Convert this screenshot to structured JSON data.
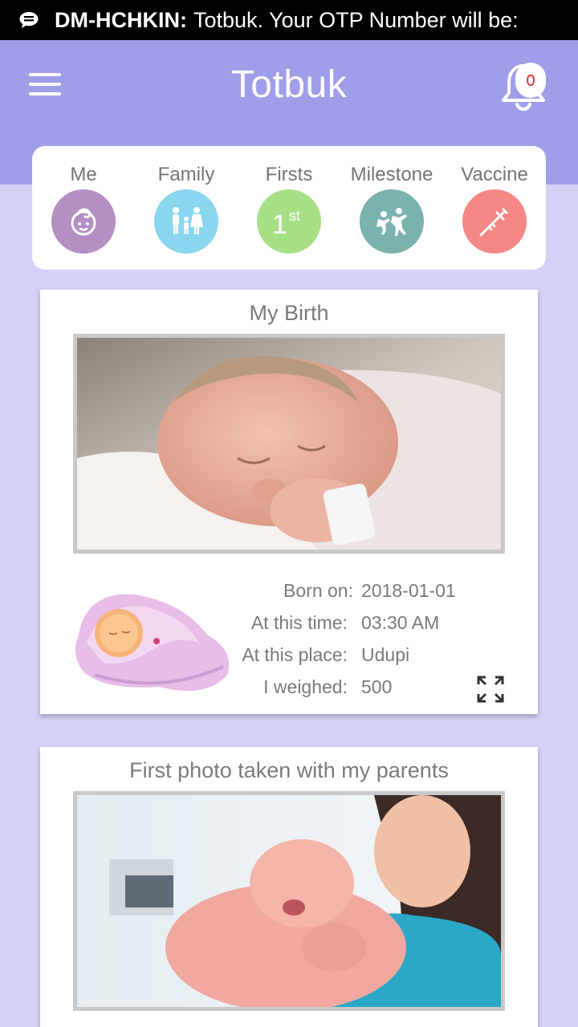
{
  "status_bar": {
    "sender": "DM-HCHKIN:",
    "message": "Totbuk. Your OTP Number will be:",
    "icon": "message-icon"
  },
  "header": {
    "title": "Totbuk",
    "menu_icon": "hamburger-menu-icon",
    "notification_icon": "bell-icon",
    "notification_count": "0"
  },
  "categories": [
    {
      "label": "Me",
      "icon": "baby-face-icon",
      "color": "#b48fc3"
    },
    {
      "label": "Family",
      "icon": "family-icon",
      "color": "#8ad6ef"
    },
    {
      "label": "Firsts",
      "icon": "first-1st-icon",
      "color": "#a7df87"
    },
    {
      "label": "Milestone",
      "icon": "kids-playing-icon",
      "color": "#7ab2b0"
    },
    {
      "label": "Vaccine",
      "icon": "syringe-icon",
      "color": "#f58785"
    }
  ],
  "birth_card": {
    "title": "My Birth",
    "rows": [
      {
        "label": "Born on:",
        "value": "2018-01-01"
      },
      {
        "label": "At this time:",
        "value": "03:30 AM"
      },
      {
        "label": "At this place:",
        "value": "Udupi"
      },
      {
        "label": "I weighed:",
        "value": "500"
      }
    ],
    "illustration": "swaddled-baby-illustration",
    "expand_icon": "expand-icon"
  },
  "parents_card": {
    "title": "First photo taken with my parents"
  },
  "colors": {
    "header": "#a09ee9",
    "background": "#d4d2f7",
    "badge_text": "#e0201f"
  }
}
